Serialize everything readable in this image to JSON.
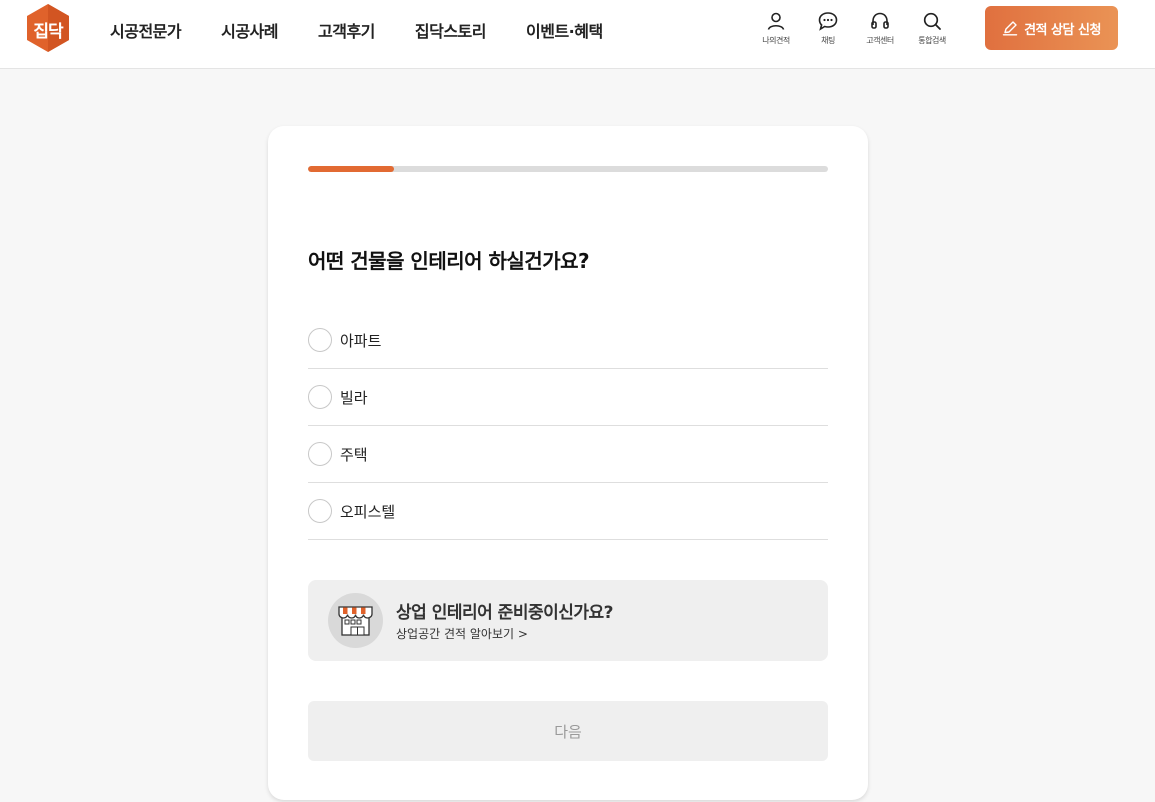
{
  "brand": {
    "logo_text": "집닥",
    "accent": "#e26a32",
    "logo_color": "#e0622b"
  },
  "nav": {
    "items": [
      {
        "label": "시공전문가"
      },
      {
        "label": "시공사례"
      },
      {
        "label": "고객후기"
      },
      {
        "label": "집닥스토리"
      },
      {
        "label": "이벤트·혜택"
      }
    ]
  },
  "utilities": [
    {
      "label": "나의견적",
      "icon": "user-icon"
    },
    {
      "label": "채팅",
      "icon": "chat-icon"
    },
    {
      "label": "고객센터",
      "icon": "headset-icon"
    },
    {
      "label": "통합검색",
      "icon": "search-icon"
    }
  ],
  "cta": {
    "label": "견적 상담 신청",
    "icon": "pencil-icon"
  },
  "survey": {
    "progress": 0.165,
    "question": "어떤 건물을 인테리어 하실건가요?",
    "options": [
      {
        "label": "아파트"
      },
      {
        "label": "빌라"
      },
      {
        "label": "주택"
      },
      {
        "label": "오피스텔"
      }
    ],
    "banner": {
      "title": "상업 인테리어 준비중이신가요?",
      "link": "상업공간 견적 알아보기 >",
      "icon": "storefront-icon"
    },
    "next_label": "다음"
  }
}
